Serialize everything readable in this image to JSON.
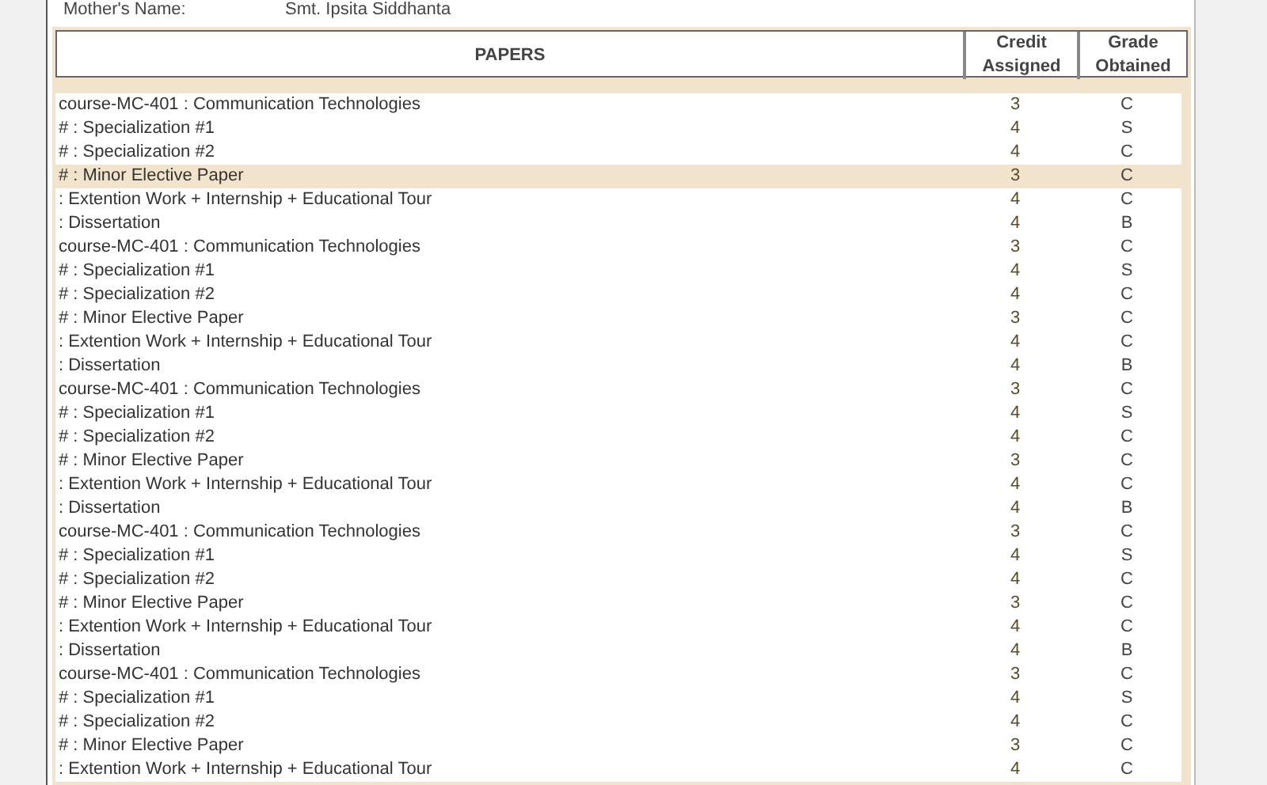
{
  "parent": {
    "label": "Mother's Name:",
    "value": "Smt. Ipsita Siddhanta"
  },
  "table": {
    "columns": [
      "PAPERS",
      "Credit Assigned",
      "Grade Obtained"
    ],
    "rows": [
      {
        "paper": "course-MC-401 : Communication Technologies",
        "credit": "3",
        "grade": "C",
        "selected": false
      },
      {
        "paper": "# : Specialization #1",
        "credit": "4",
        "grade": "S",
        "selected": false
      },
      {
        "paper": "# : Specialization #2",
        "credit": "4",
        "grade": "C",
        "selected": false
      },
      {
        "paper": "# : Minor Elective Paper",
        "credit": "3",
        "grade": "C",
        "selected": true
      },
      {
        "paper": ": Extention Work + Internship + Educational Tour",
        "credit": "4",
        "grade": "C",
        "selected": false
      },
      {
        "paper": ": Dissertation",
        "credit": "4",
        "grade": "B",
        "selected": false
      },
      {
        "paper": "course-MC-401 : Communication Technologies",
        "credit": "3",
        "grade": "C",
        "selected": false
      },
      {
        "paper": "# : Specialization #1",
        "credit": "4",
        "grade": "S",
        "selected": false
      },
      {
        "paper": "# : Specialization #2",
        "credit": "4",
        "grade": "C",
        "selected": false
      },
      {
        "paper": "# : Minor Elective Paper",
        "credit": "3",
        "grade": "C",
        "selected": false
      },
      {
        "paper": ": Extention Work + Internship + Educational Tour",
        "credit": "4",
        "grade": "C",
        "selected": false
      },
      {
        "paper": ": Dissertation",
        "credit": "4",
        "grade": "B",
        "selected": false
      },
      {
        "paper": "course-MC-401 : Communication Technologies",
        "credit": "3",
        "grade": "C",
        "selected": false
      },
      {
        "paper": "# : Specialization #1",
        "credit": "4",
        "grade": "S",
        "selected": false
      },
      {
        "paper": "# : Specialization #2",
        "credit": "4",
        "grade": "C",
        "selected": false
      },
      {
        "paper": "# : Minor Elective Paper",
        "credit": "3",
        "grade": "C",
        "selected": false
      },
      {
        "paper": ": Extention Work + Internship + Educational Tour",
        "credit": "4",
        "grade": "C",
        "selected": false
      },
      {
        "paper": ": Dissertation",
        "credit": "4",
        "grade": "B",
        "selected": false
      },
      {
        "paper": "course-MC-401 : Communication Technologies",
        "credit": "3",
        "grade": "C",
        "selected": false
      },
      {
        "paper": "# : Specialization #1",
        "credit": "4",
        "grade": "S",
        "selected": false
      },
      {
        "paper": "# : Specialization #2",
        "credit": "4",
        "grade": "C",
        "selected": false
      },
      {
        "paper": "# : Minor Elective Paper",
        "credit": "3",
        "grade": "C",
        "selected": false
      },
      {
        "paper": ": Extention Work + Internship + Educational Tour",
        "credit": "4",
        "grade": "C",
        "selected": false
      },
      {
        "paper": ": Dissertation",
        "credit": "4",
        "grade": "B",
        "selected": false
      },
      {
        "paper": "course-MC-401 : Communication Technologies",
        "credit": "3",
        "grade": "C",
        "selected": false
      },
      {
        "paper": "# : Specialization #1",
        "credit": "4",
        "grade": "S",
        "selected": false
      },
      {
        "paper": "# : Specialization #2",
        "credit": "4",
        "grade": "C",
        "selected": false
      },
      {
        "paper": "# : Minor Elective Paper",
        "credit": "3",
        "grade": "C",
        "selected": false
      },
      {
        "paper": ": Extention Work + Internship + Educational Tour",
        "credit": "4",
        "grade": "C",
        "selected": false
      }
    ]
  }
}
